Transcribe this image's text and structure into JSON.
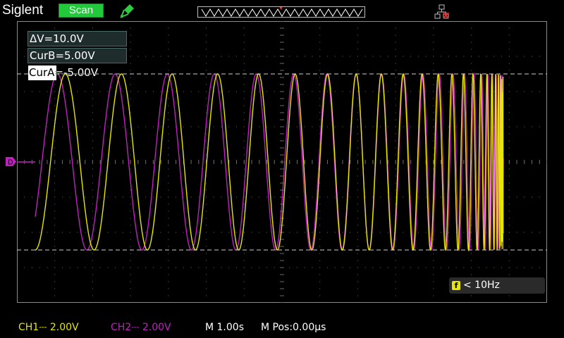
{
  "header": {
    "brand": "Siglent",
    "mode_label": "Scan",
    "probe_icon": "probe-icon",
    "network_icon": "network-disconnected-icon"
  },
  "cursors": {
    "delta": "ΔV=10.0V",
    "cur_b": "CurB=5.00V",
    "cur_a": "CurA=-5.00V"
  },
  "trigger": {
    "freq_badge": "f",
    "freq_text": "< 10Hz"
  },
  "status": {
    "ch1": "CH1⎓ 2.00V",
    "ch2": "CH2⎓ 2.00V",
    "timebase": "M 1.00s",
    "mpos": "M Pos:0.00μs"
  },
  "colors": {
    "ch1": "#e6e600",
    "ch2": "#c020c0",
    "grid": "#6a6a6a",
    "background": "#000000",
    "mode_button": "#22c93a"
  }
}
